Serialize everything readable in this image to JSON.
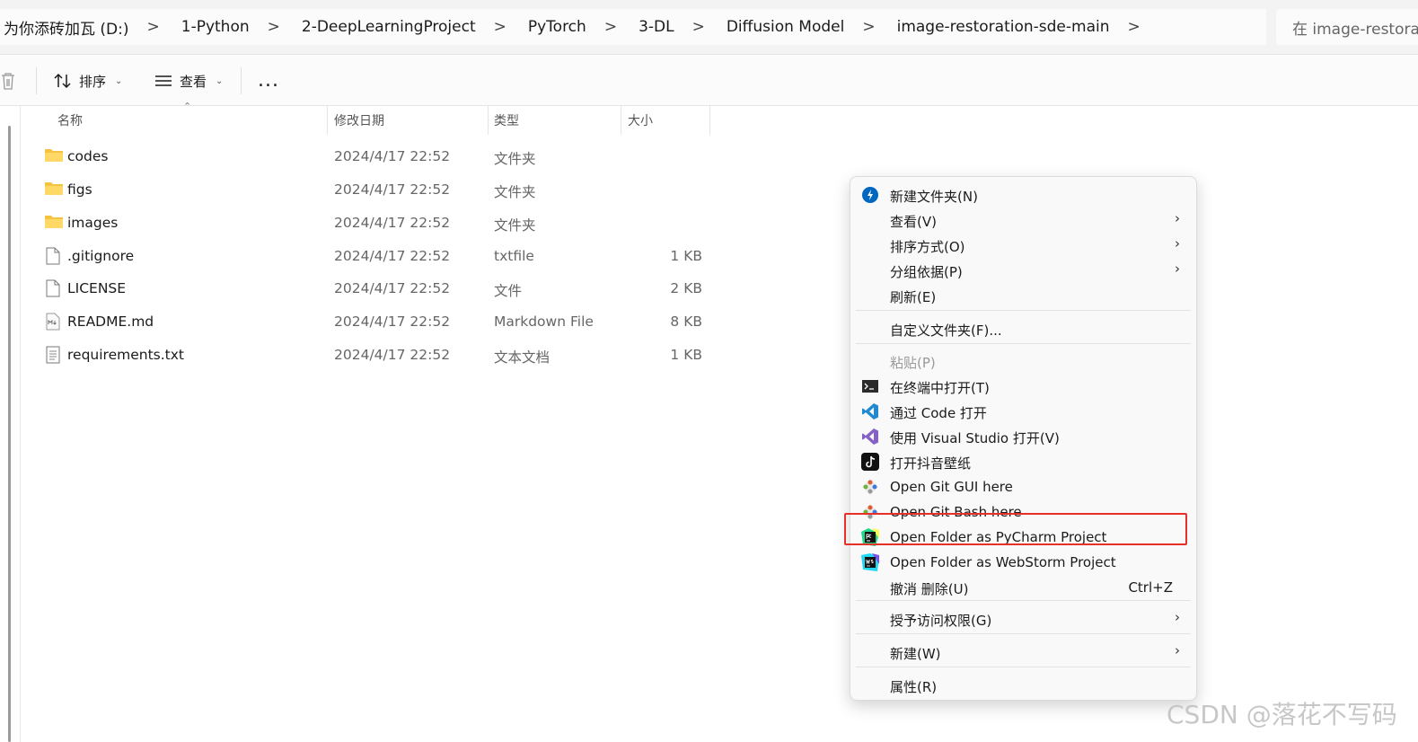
{
  "breadcrumb": [
    "为你添砖加瓦 (D:)",
    "1-Python",
    "2-DeepLearningProject",
    "PyTorch",
    "3-DL",
    "Diffusion Model",
    "image-restoration-sde-main"
  ],
  "breadcrumb_sep": ">",
  "search": {
    "text": "在 image-restora"
  },
  "toolbar": {
    "sort_label": "排序",
    "view_label": "查看",
    "more": "..."
  },
  "columns": {
    "name": "名称",
    "date": "修改日期",
    "type": "类型",
    "size": "大小"
  },
  "files": [
    {
      "name": "codes",
      "date": "2024/4/17 22:52",
      "type": "文件夹",
      "size": "",
      "icon": "folder-icon"
    },
    {
      "name": "figs",
      "date": "2024/4/17 22:52",
      "type": "文件夹",
      "size": "",
      "icon": "folder-icon"
    },
    {
      "name": "images",
      "date": "2024/4/17 22:52",
      "type": "文件夹",
      "size": "",
      "icon": "folder-icon"
    },
    {
      "name": ".gitignore",
      "date": "2024/4/17 22:52",
      "type": "txtfile",
      "size": "1 KB",
      "icon": "file-icon"
    },
    {
      "name": "LICENSE",
      "date": "2024/4/17 22:52",
      "type": "文件",
      "size": "2 KB",
      "icon": "file-icon"
    },
    {
      "name": "README.md",
      "date": "2024/4/17 22:52",
      "type": "Markdown File",
      "size": "8 KB",
      "icon": "markdown-file-icon"
    },
    {
      "name": "requirements.txt",
      "date": "2024/4/17 22:52",
      "type": "文本文档",
      "size": "1 KB",
      "icon": "text-file-icon"
    }
  ],
  "menu": {
    "new_folder": "新建文件夹(N)",
    "view": "查看(V)",
    "sort_by": "排序方式(O)",
    "group_by": "分组依据(P)",
    "refresh": "刷新(E)",
    "customize": "自定义文件夹(F)...",
    "paste": "粘贴(P)",
    "terminal": "在终端中打开(T)",
    "vscode": "通过 Code 打开",
    "visual_studio": "使用 Visual Studio 打开(V)",
    "douyin": "打开抖音壁纸",
    "git_gui": "Open Git GUI here",
    "git_bash": "Open Git Bash here",
    "pycharm": "Open Folder as PyCharm Project",
    "webstorm": "Open Folder as WebStorm Project",
    "undo_delete": "撤消 删除(U)",
    "undo_shortcut": "Ctrl+Z",
    "grant_access": "授予访问权限(G)",
    "new": "新建(W)",
    "properties": "属性(R)",
    "submenu_arrow": "›"
  },
  "watermark": "CSDN @落花不写码",
  "colors": {
    "highlight_border": "#e8302a",
    "folder": "#f5c342",
    "accent": "#0067c0"
  }
}
